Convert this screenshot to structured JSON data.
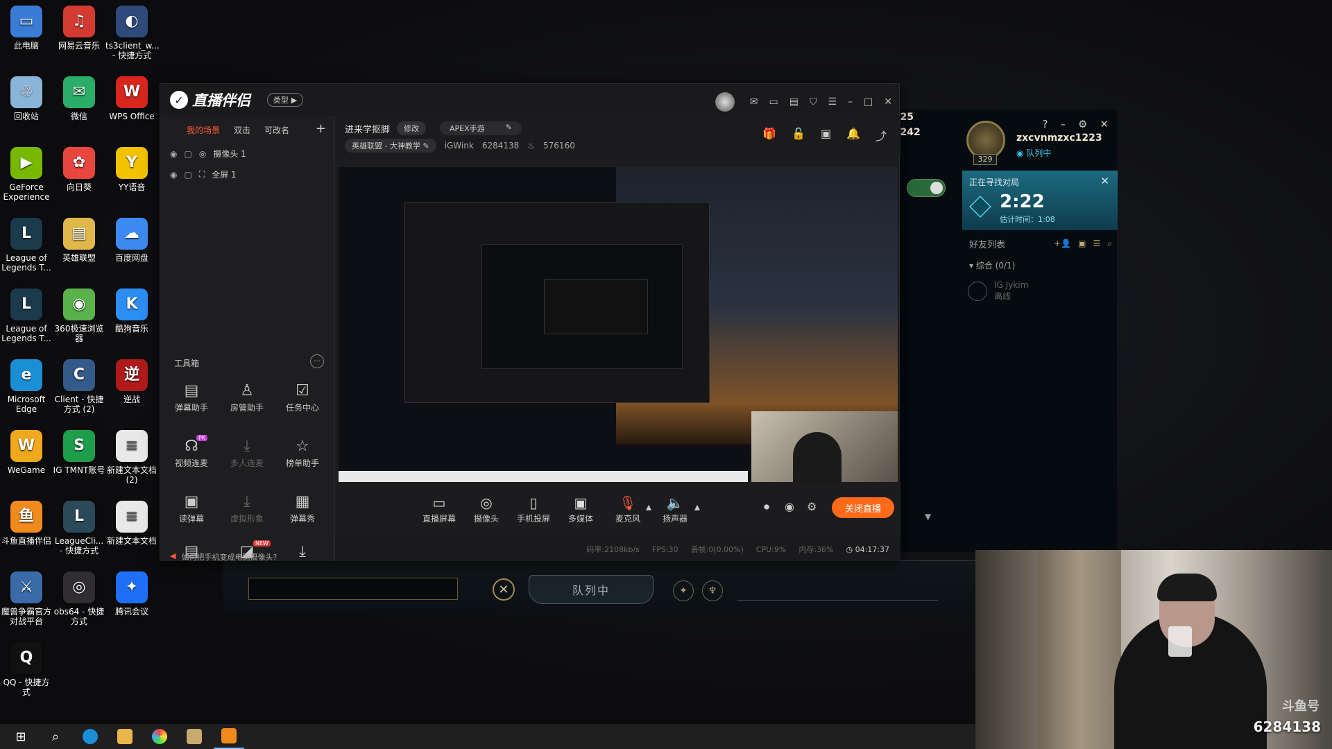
{
  "desktop": {
    "icons": [
      {
        "label": "此电脑",
        "icon": "computer-icon",
        "color": "#3a7bd5"
      },
      {
        "label": "网易云音乐",
        "icon": "netease-music-icon",
        "color": "#d33a31"
      },
      {
        "label": "ts3client_w... - 快捷方式",
        "icon": "teamspeak-icon",
        "color": "#2d4a7a"
      },
      {
        "label": "回收站",
        "icon": "recycle-bin-icon",
        "color": "#8ab4d8"
      },
      {
        "label": "微信",
        "icon": "wechat-icon",
        "color": "#2aae67"
      },
      {
        "label": "WPS Office",
        "icon": "wps-icon",
        "color": "#d9261c"
      },
      {
        "label": "GeForce Experience",
        "icon": "geforce-icon",
        "color": "#76b900"
      },
      {
        "label": "向日葵",
        "icon": "sunflower-icon",
        "color": "#e8453c"
      },
      {
        "label": "YY语音",
        "icon": "yy-icon",
        "color": "#f2c200"
      },
      {
        "label": "League of Legends T...",
        "icon": "league-icon",
        "color": "#1b3a4b"
      },
      {
        "label": "英雄联盟",
        "icon": "folder-icon",
        "color": "#e0b84a"
      },
      {
        "label": "百度网盘",
        "icon": "baidu-disk-icon",
        "color": "#3d8bf2"
      },
      {
        "label": "League of Legends T...",
        "icon": "league-icon",
        "color": "#1b3a4b"
      },
      {
        "label": "360极速浏览器",
        "icon": "360-browser-icon",
        "color": "#5ab24a"
      },
      {
        "label": "酷狗音乐",
        "icon": "kugou-icon",
        "color": "#2c8ef5"
      },
      {
        "label": "Microsoft Edge",
        "icon": "edge-icon",
        "color": "#1b8fd6"
      },
      {
        "label": "Client - 快捷方式 (2)",
        "icon": "client-icon",
        "color": "#345a8a"
      },
      {
        "label": "逆战",
        "icon": "nizhan-icon",
        "color": "#b01a1a"
      },
      {
        "label": "WeGame",
        "icon": "wegame-icon",
        "color": "#f0a81c"
      },
      {
        "label": "IG TMNT账号",
        "icon": "document-icon",
        "color": "#1e9e4a"
      },
      {
        "label": "新建文本文档 (2)",
        "icon": "text-file-icon",
        "color": "#e8e8e8"
      },
      {
        "label": "斗鱼直播伴侣",
        "icon": "douyu-icon",
        "color": "#f08a1c"
      },
      {
        "label": "LeagueCli... - 快捷方式",
        "icon": "league-client-icon",
        "color": "#2a4a5a"
      },
      {
        "label": "新建文本文档",
        "icon": "text-file-icon",
        "color": "#e8e8e8"
      },
      {
        "label": "魔兽争霸官方对战平台",
        "icon": "warcraft-icon",
        "color": "#3a6aa8"
      },
      {
        "label": "obs64 - 快捷方式",
        "icon": "obs-icon",
        "color": "#302e31"
      },
      {
        "label": "腾讯会议",
        "icon": "tencent-meeting-icon",
        "color": "#1e6ff5"
      },
      {
        "label": "QQ - 快捷方式",
        "icon": "qq-icon",
        "color": "#111"
      }
    ]
  },
  "lol": {
    "stat1": "225",
    "stat2": "3242",
    "level": "329",
    "username": "zxcvnmzxc1223",
    "status": "队列中",
    "search_title": "正在寻找对局",
    "timer": "2:22",
    "estimate": "估计时间：1:08",
    "friends_title": "好友列表",
    "group": "综合 (0/1)",
    "friend_name": "IG Jykim",
    "friend_status": "离线",
    "queue_label": "队列中"
  },
  "zb": {
    "type_label": "类型",
    "scene_tabs": [
      "我的场景",
      "双击",
      "可改名"
    ],
    "sources": [
      "摄像头 1",
      "全屏 1"
    ],
    "toolbox_title": "工具箱",
    "tools": [
      {
        "label": "弹幕助手",
        "icon": "danmaku-icon",
        "dim": false
      },
      {
        "label": "房管助手",
        "icon": "room-admin-icon",
        "dim": false
      },
      {
        "label": "任务中心",
        "icon": "task-center-icon",
        "dim": false
      },
      {
        "label": "视频连麦",
        "icon": "video-link-icon",
        "dim": false,
        "badge": "PK"
      },
      {
        "label": "多人连麦",
        "icon": "download-icon",
        "dim": true
      },
      {
        "label": "榜单助手",
        "icon": "ranking-icon",
        "dim": false
      },
      {
        "label": "读弹幕",
        "icon": "read-danmaku-icon",
        "dim": false
      },
      {
        "label": "虚拟形象",
        "icon": "download-icon",
        "dim": true
      },
      {
        "label": "弹幕秀",
        "icon": "danmaku-show-icon",
        "dim": false
      }
    ],
    "notice": "如何把手机变成电脑摄像头?",
    "header": {
      "title": "进来学抠脚",
      "edit_label": "修改",
      "game": "APEX手游",
      "category": "英雄联盟 - 大神教学",
      "user": "iGWink",
      "room_id": "6284138",
      "heat": "576160"
    },
    "controls": [
      {
        "label": "直播屏幕",
        "icon": "screen-icon"
      },
      {
        "label": "摄像头",
        "icon": "camera-icon"
      },
      {
        "label": "手机投屏",
        "icon": "phone-cast-icon"
      },
      {
        "label": "多媒体",
        "icon": "multimedia-icon"
      },
      {
        "label": "麦克风",
        "icon": "microphone-icon"
      },
      {
        "label": "扬声器",
        "icon": "speaker-icon"
      }
    ],
    "close_live_label": "关闭直播",
    "status": {
      "bitrate": "码率:2108kb/s",
      "fps": "FPS:30",
      "drop": "丢帧:0(0.00%)",
      "cpu": "CPU:9%",
      "mem": "内存:36%",
      "time": "04:17:37"
    }
  },
  "webcam": {
    "room_id": "6284138",
    "watermark": "斗鱼号"
  }
}
